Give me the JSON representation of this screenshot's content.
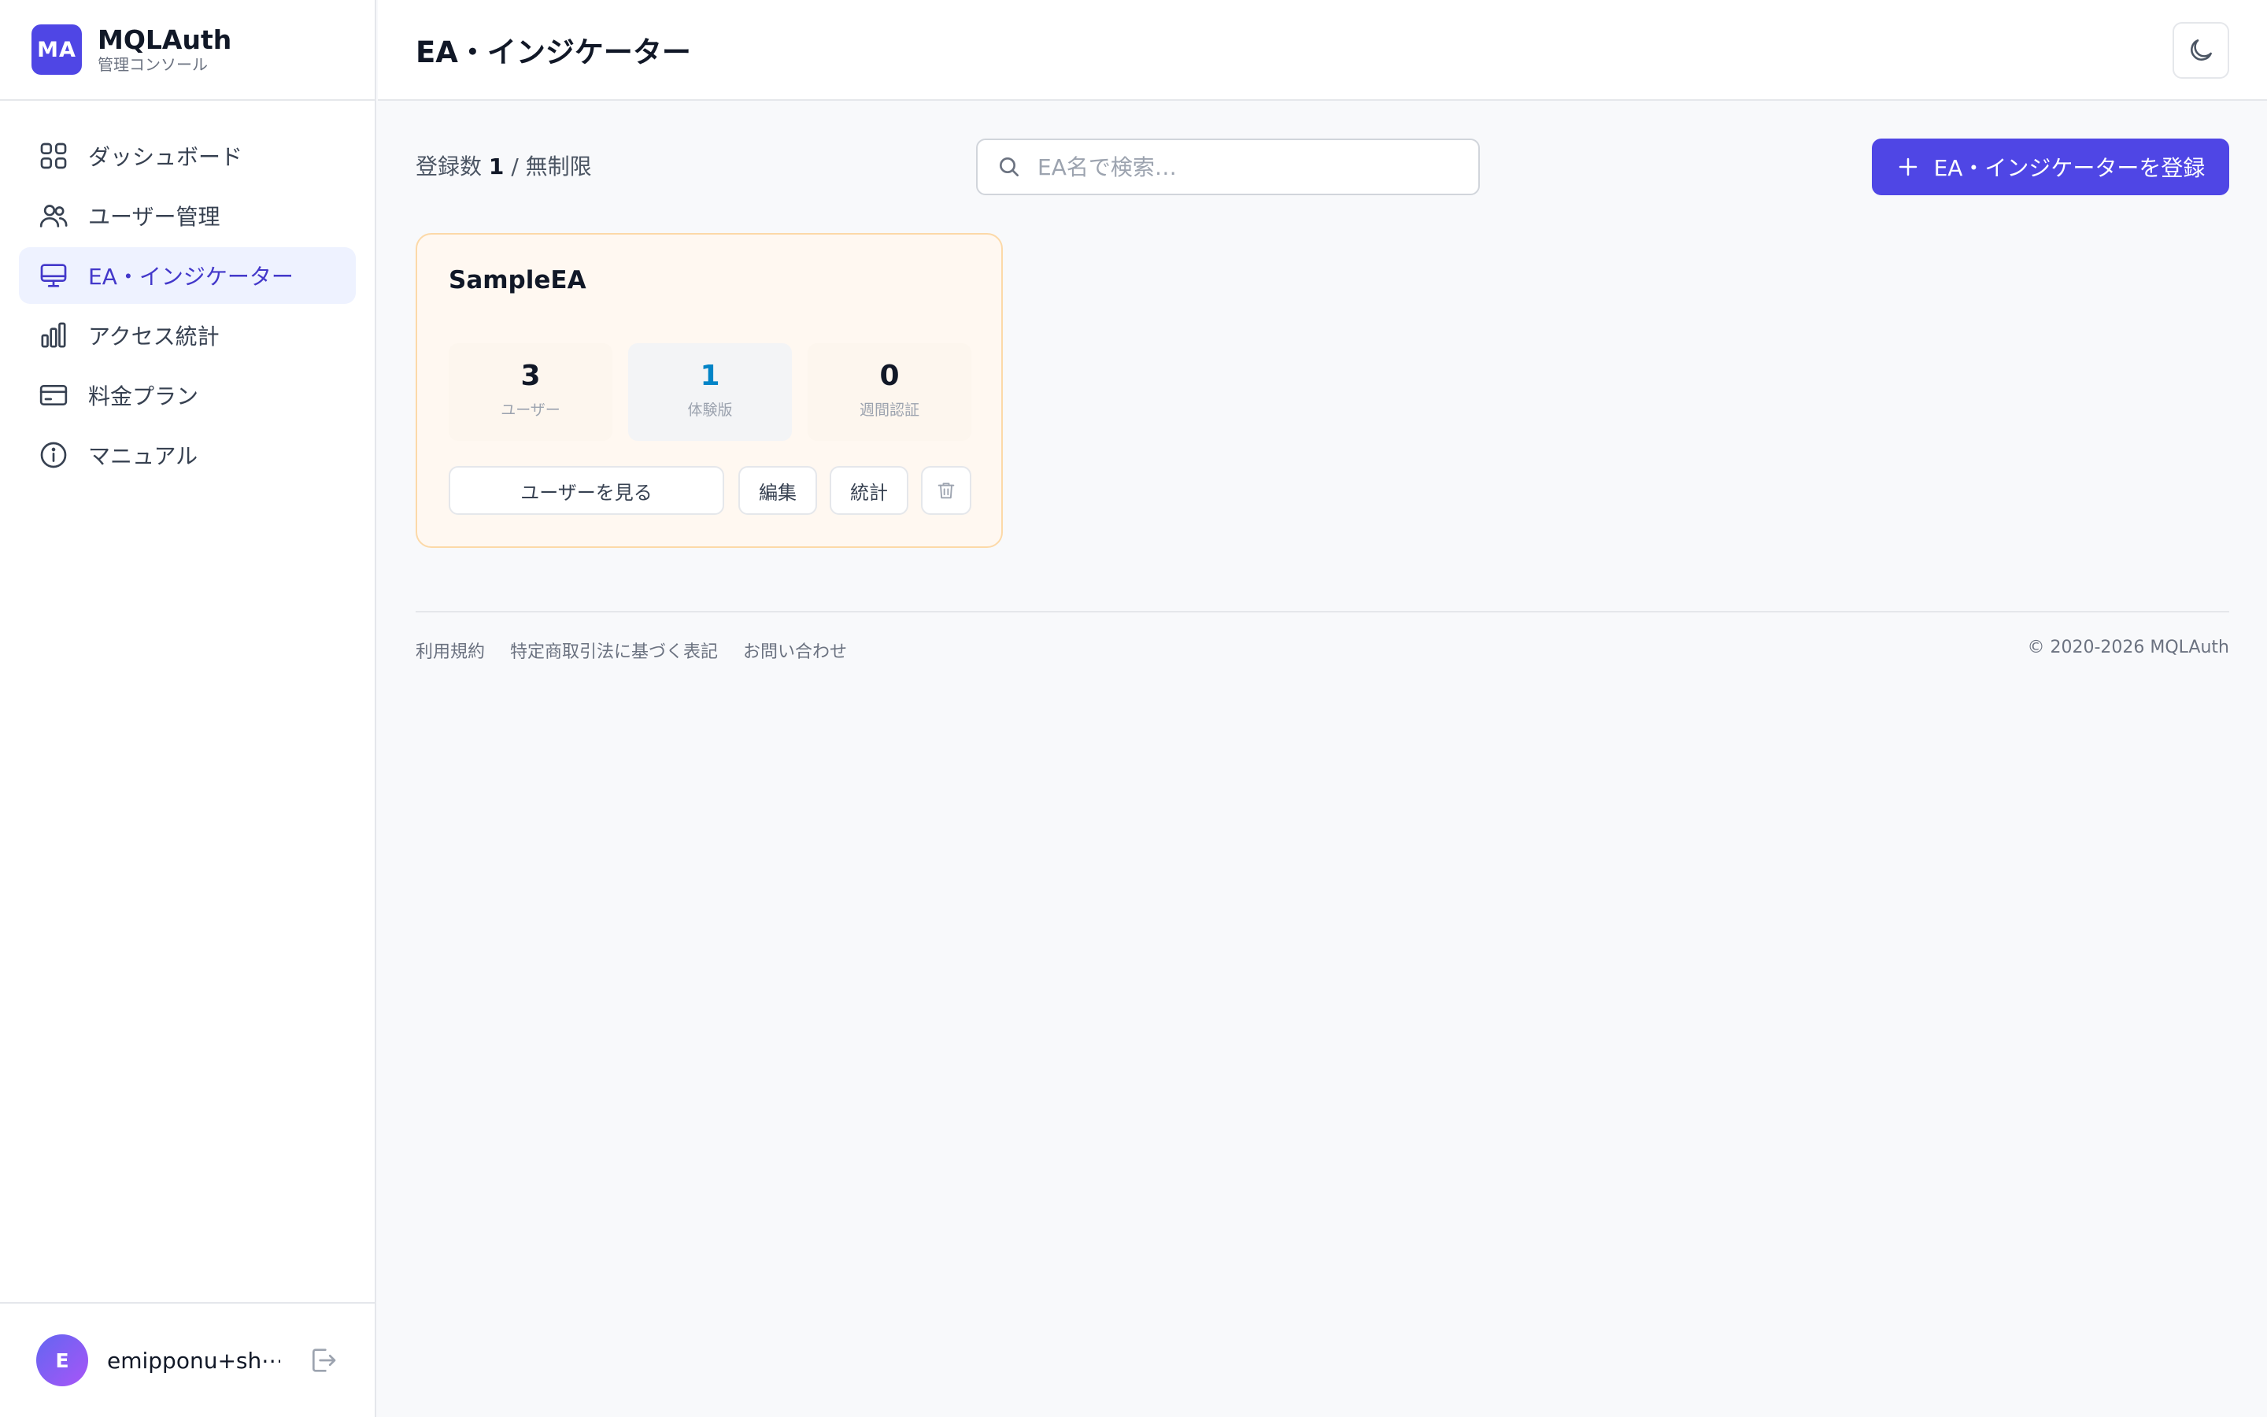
{
  "brand": {
    "logo": "MA",
    "name": "MQLAuth",
    "subtitle": "管理コンソール"
  },
  "sidebar": {
    "items": [
      {
        "label": "ダッシュボード",
        "icon": "grid-icon"
      },
      {
        "label": "ユーザー管理",
        "icon": "users-icon"
      },
      {
        "label": "EA・インジケーター",
        "icon": "monitor-icon",
        "active": true
      },
      {
        "label": "アクセス統計",
        "icon": "bar-chart-icon"
      },
      {
        "label": "料金プラン",
        "icon": "credit-card-icon"
      },
      {
        "label": "マニュアル",
        "icon": "info-icon"
      }
    ]
  },
  "user": {
    "avatar": "E",
    "email": "emipponu+sh⋯"
  },
  "header": {
    "title": "EA・インジケーター"
  },
  "toolbar": {
    "count_prefix": "登録数",
    "count": "1",
    "count_suffix": "/ 無制限",
    "search_placeholder": "EA名で検索…",
    "add_label": "EA・インジケーターを登録"
  },
  "cards": [
    {
      "name": "SampleEA",
      "stats": [
        {
          "value": "3",
          "label": "ユーザー"
        },
        {
          "value": "1",
          "label": "体験版"
        },
        {
          "value": "0",
          "label": "週間認証"
        }
      ],
      "view_users_label": "ユーザーを見る",
      "edit_label": "編集",
      "stats_label": "統計"
    }
  ],
  "footer": {
    "links": [
      "利用規約",
      "特定商取引法に基づく表記",
      "お問い合わせ"
    ],
    "copyright": "© 2020-2026 MQLAuth"
  },
  "colors": {
    "accent": "#4f46e5",
    "active_bg": "#eef2ff",
    "trial_value": "#0284c7",
    "card_border": "#fcd9a8"
  }
}
